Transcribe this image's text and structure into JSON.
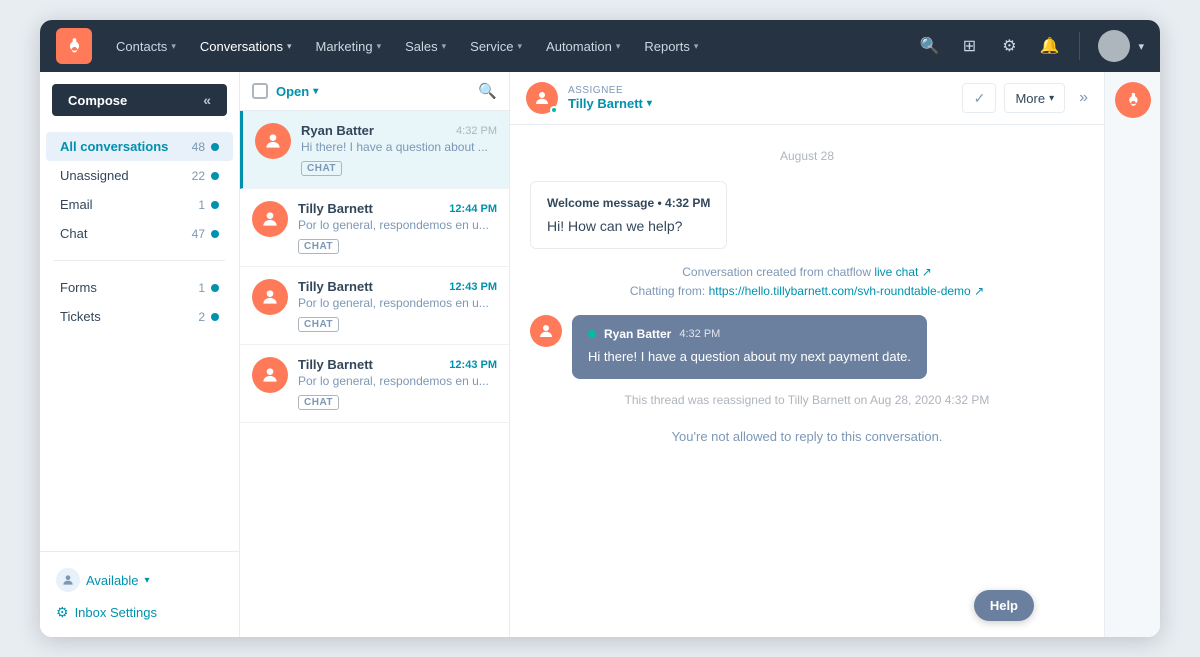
{
  "nav": {
    "items": [
      {
        "label": "Contacts",
        "id": "contacts"
      },
      {
        "label": "Conversations",
        "id": "conversations"
      },
      {
        "label": "Marketing",
        "id": "marketing"
      },
      {
        "label": "Sales",
        "id": "sales"
      },
      {
        "label": "Service",
        "id": "service"
      },
      {
        "label": "Automation",
        "id": "automation"
      },
      {
        "label": "Reports",
        "id": "reports"
      }
    ]
  },
  "sidebar": {
    "compose_label": "Compose",
    "items": [
      {
        "label": "All conversations",
        "count": "48",
        "active": true
      },
      {
        "label": "Unassigned",
        "count": "22"
      },
      {
        "label": "Email",
        "count": "1"
      },
      {
        "label": "Chat",
        "count": "47"
      }
    ],
    "items2": [
      {
        "label": "Forms",
        "count": "1"
      },
      {
        "label": "Tickets",
        "count": "2"
      }
    ],
    "available_label": "Available",
    "inbox_settings_label": "Inbox Settings"
  },
  "conv_list": {
    "filter_label": "Open",
    "conversations": [
      {
        "name": "Ryan Batter",
        "time": "4:32 PM",
        "preview": "Hi there! I have a question about ...",
        "badge": "CHAT",
        "active": true,
        "unread": false
      },
      {
        "name": "Tilly Barnett",
        "time": "12:44 PM",
        "preview": "Por lo general, respondemos en u...",
        "badge": "CHAT",
        "active": false,
        "unread": true
      },
      {
        "name": "Tilly Barnett",
        "time": "12:43 PM",
        "preview": "Por lo general, respondemos en u...",
        "badge": "CHAT",
        "active": false,
        "unread": true
      },
      {
        "name": "Tilly Barnett",
        "time": "12:43 PM",
        "preview": "Por lo general, respondemos en u...",
        "badge": "CHAT",
        "active": false,
        "unread": true
      }
    ]
  },
  "chat": {
    "assignee_label": "Assignee",
    "assignee_name": "Tilly Barnett",
    "more_label": "More",
    "date_divider": "August 28",
    "welcome_message_header": "Welcome message • 4:32 PM",
    "welcome_message_text": "Hi! How can we help?",
    "system_message_1": "Conversation created from chatflow",
    "live_chat_link": "live chat",
    "system_message_2": "Chatting from:",
    "chatting_url": "https://hello.tillybarnett.com/svh-roundtable-demo",
    "bubble_sender": "Ryan Batter",
    "bubble_time": "4:32 PM",
    "bubble_text": "Hi there! I have a question about my next payment date.",
    "reassign_msg": "This thread was reassigned to Tilly Barnett on Aug 28, 2020 4:32 PM",
    "no_reply_msg": "You're not allowed to reply to this conversation.",
    "help_label": "Help"
  }
}
